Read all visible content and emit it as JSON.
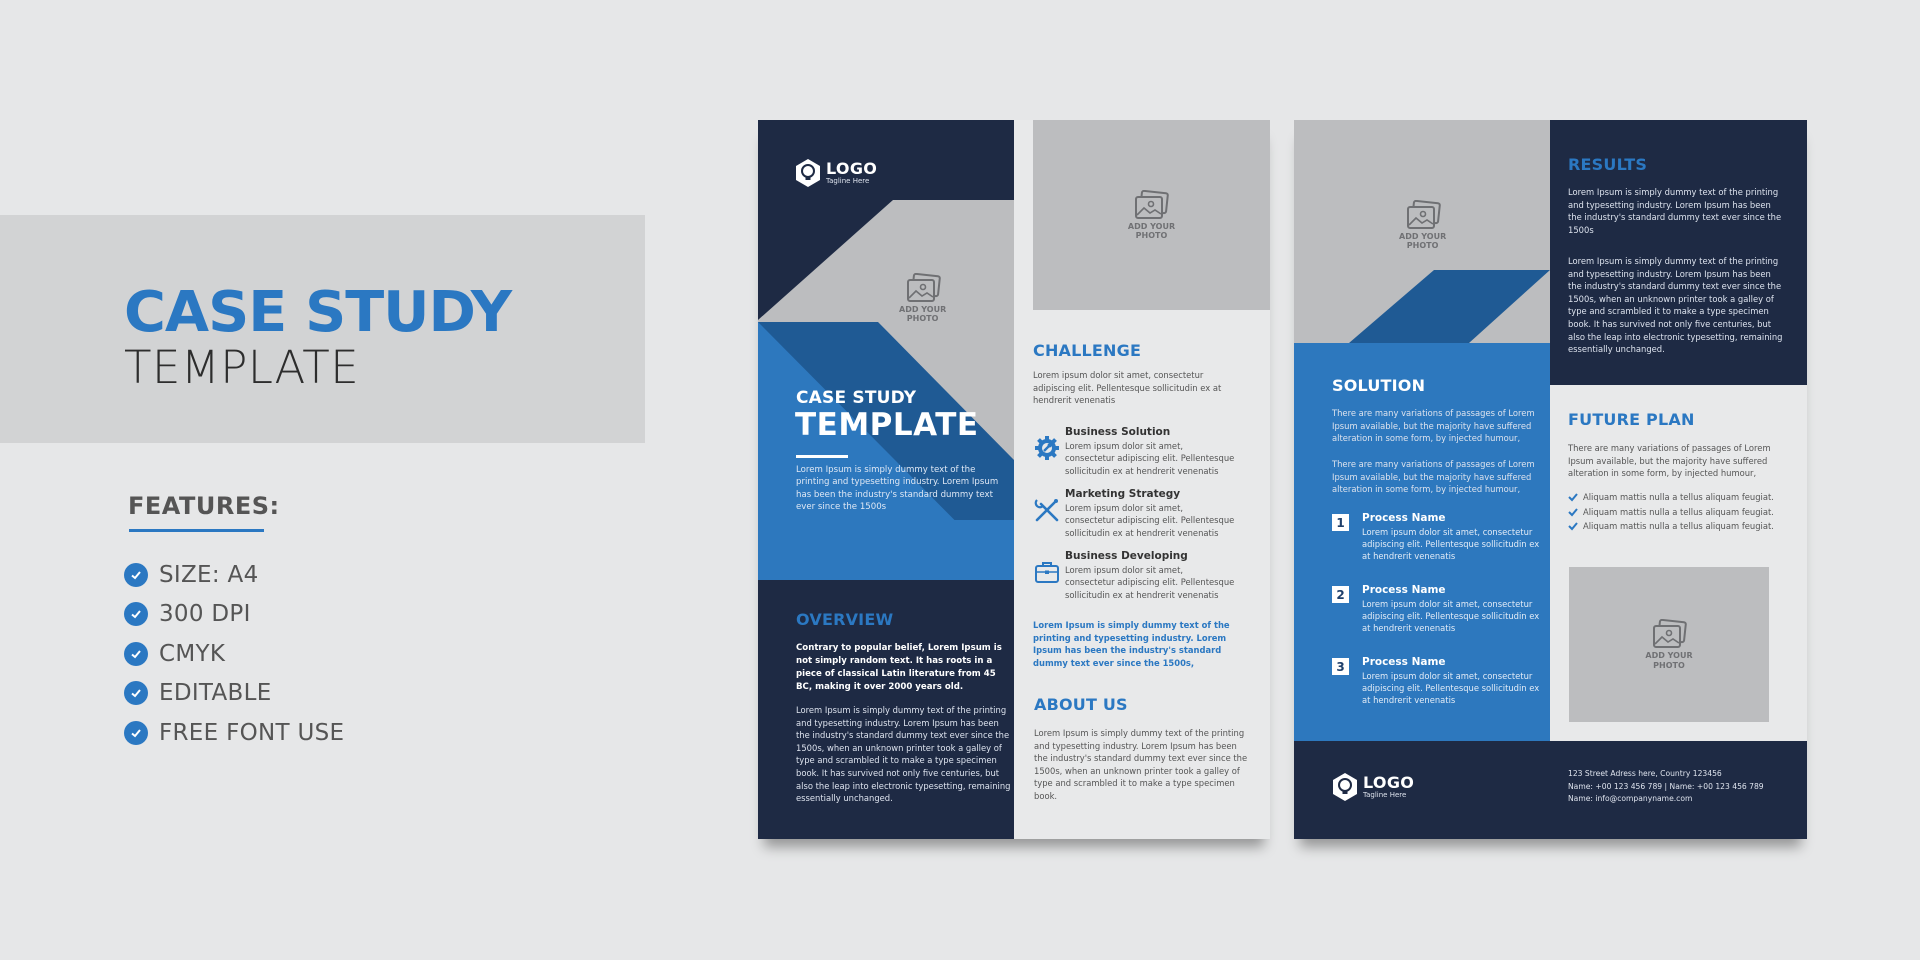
{
  "promo": {
    "title": "CASE STUDY",
    "subtitle": "TEMPLATE",
    "features_heading": "FEATURES:",
    "features": [
      "SIZE: A4",
      "300 DPI",
      "CMYK",
      "EDITABLE",
      "FREE FONT USE"
    ]
  },
  "colors": {
    "navy": "#1e2a44",
    "blue": "#2d78be",
    "dark_blue": "#1f5a94",
    "photo_gray": "#bcbdbf",
    "background": "#e6e7e8"
  },
  "logo": {
    "word": "LOGO",
    "tagline": "Tagline Here",
    "icon": "lightbulb-hexagon-icon"
  },
  "photo_placeholder": {
    "line1": "ADD YOUR",
    "line2": "PHOTO",
    "icon": "image-stack-icon"
  },
  "cover": {
    "kicker": "CASE STUDY",
    "title": "TEMPLATE",
    "text": "Lorem Ipsum is simply dummy text of the printing and typesetting industry. Lorem Ipsum has been the industry's standard dummy text ever since the 1500s"
  },
  "overview": {
    "heading": "OVERVIEW",
    "lead": "Contrary to popular belief, Lorem Ipsum is not simply random text. It has roots in a piece of classical Latin literature from 45 BC, making it over 2000 years old.",
    "body": "Lorem Ipsum is simply dummy text of the printing and typesetting industry. Lorem Ipsum has been the industry's standard dummy text ever since the 1500s, when an unknown printer took a galley of type and scrambled it to make a type specimen book. It has survived not only five centuries, but also the leap into electronic typesetting, remaining essentially unchanged."
  },
  "challenge": {
    "heading": "CHALLENGE",
    "body": "Lorem ipsum dolor sit amet, consectetur adipiscing elit. Pellentesque sollicitudin ex at hendrerit venenatis",
    "services": [
      {
        "icon": "gear-wrench-icon",
        "title": "Business Solution",
        "desc": "Lorem ipsum dolor sit amet, consectetur adipiscing elit. Pellentesque sollicitudin ex at hendrerit venenatis"
      },
      {
        "icon": "tools-icon",
        "title": "Marketing Strategy",
        "desc": "Lorem ipsum dolor sit amet, consectetur adipiscing elit. Pellentesque sollicitudin ex at hendrerit venenatis"
      },
      {
        "icon": "briefcase-icon",
        "title": "Business Developing",
        "desc": "Lorem ipsum dolor sit amet, consectetur adipiscing elit. Pellentesque sollicitudin ex at hendrerit venenatis"
      }
    ],
    "highlight": "Lorem Ipsum is simply dummy text of the printing and typesetting industry. Lorem Ipsum has been the industry's standard dummy text ever since the 1500s,"
  },
  "about": {
    "heading": "ABOUT US",
    "body": "Lorem Ipsum is simply dummy text of the printing and typesetting industry. Lorem Ipsum has been the industry's standard dummy text ever since the 1500s, when an unknown printer took a galley of type and scrambled it to make a type specimen book."
  },
  "solution": {
    "heading": "SOLUTION",
    "p1": "There are many variations of passages of Lorem Ipsum available, but the majority have suffered alteration in some form, by injected humour,",
    "p2": "There are many variations of passages of Lorem Ipsum available, but the majority have suffered alteration in some form, by injected humour,",
    "processes": [
      {
        "num": "1",
        "title": "Process Name",
        "desc": "Lorem ipsum dolor sit amet, consectetur adipiscing elit. Pellentesque sollicitudin ex at hendrerit venenatis"
      },
      {
        "num": "2",
        "title": "Process Name",
        "desc": "Lorem ipsum dolor sit amet, consectetur adipiscing elit. Pellentesque sollicitudin ex at hendrerit venenatis"
      },
      {
        "num": "3",
        "title": "Process Name",
        "desc": "Lorem ipsum dolor sit amet, consectetur adipiscing elit. Pellentesque sollicitudin ex at hendrerit venenatis"
      }
    ]
  },
  "results": {
    "heading": "RESULTS",
    "p1": "Lorem Ipsum is simply dummy text of the printing and typesetting industry. Lorem Ipsum has been the industry's standard dummy text ever since the 1500s",
    "p2": "Lorem Ipsum is simply dummy text of the printing and typesetting industry. Lorem Ipsum has been the industry's standard dummy text ever since the 1500s, when an unknown printer took a galley of type and scrambled it to make a type specimen book. It has survived not only five centuries, but also the leap into electronic typesetting, remaining essentially unchanged."
  },
  "future_plan": {
    "heading": "FUTURE PLAN",
    "body": "There are many variations of passages of Lorem Ipsum available, but the majority have suffered alteration in some form, by injected humour,",
    "bullets": [
      "Aliquam mattis nulla a tellus aliquam feugiat.",
      "Aliquam mattis nulla a tellus aliquam feugiat.",
      "Aliquam mattis nulla a tellus aliquam feugiat."
    ]
  },
  "footer": {
    "address": "123 Street Adress here, Country 123456",
    "phones": "Name: +00 123 456 789 |  Name: +00 123 456 789",
    "email": "Name: info@companyname.com"
  }
}
